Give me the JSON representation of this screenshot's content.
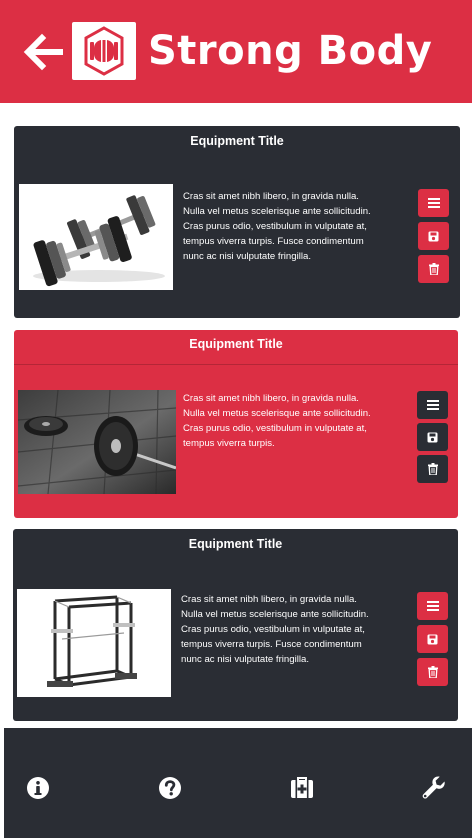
{
  "app": {
    "title": "Strong Body",
    "colors": {
      "accent": "#dc2f44",
      "dark": "#2a2d34",
      "background": "#ffffff"
    },
    "icons": {
      "back": "arrow-left-icon",
      "logo": "strong-body-logo"
    }
  },
  "cards": [
    {
      "title": "Equipment Title",
      "desc_lines": [
        "Cras sit amet nibh libero, in gravida nulla.",
        "Nulla vel metus scelerisque ante sollicitudin.",
        "Cras purus odio, vestibulum in vulputate at,",
        "tempus viverra turpis. Fusce condimentum",
        "nunc ac nisi vulputate fringilla."
      ],
      "image": "dumbbells",
      "style": "dark",
      "actions": [
        "menu-icon",
        "save-icon",
        "trash-icon"
      ]
    },
    {
      "title": "Equipment Title",
      "desc_lines": [
        "Cras sit amet nibh libero, in gravida nulla.",
        "Nulla vel metus scelerisque ante sollicitudin.",
        "Cras purus odio, vestibulum in vulputate at,",
        "tempus viverra turpis."
      ],
      "image": "barbell",
      "style": "red",
      "actions": [
        "menu-icon",
        "save-icon",
        "trash-icon"
      ]
    },
    {
      "title": "Equipment Title",
      "desc_lines": [
        "Cras sit amet nibh libero, in gravida nulla.",
        "Nulla vel metus scelerisque ante sollicitudin.",
        "Cras purus odio, vestibulum in vulputate at,",
        "tempus viverra turpis. Fusce condimentum",
        "nunc ac nisi vulputate fringilla."
      ],
      "image": "squat-rack",
      "style": "dark",
      "actions": [
        "menu-icon",
        "save-icon",
        "trash-icon"
      ]
    }
  ],
  "footer": {
    "icons": [
      "info-icon",
      "help-icon",
      "first-aid-icon",
      "wrench-icon"
    ]
  }
}
